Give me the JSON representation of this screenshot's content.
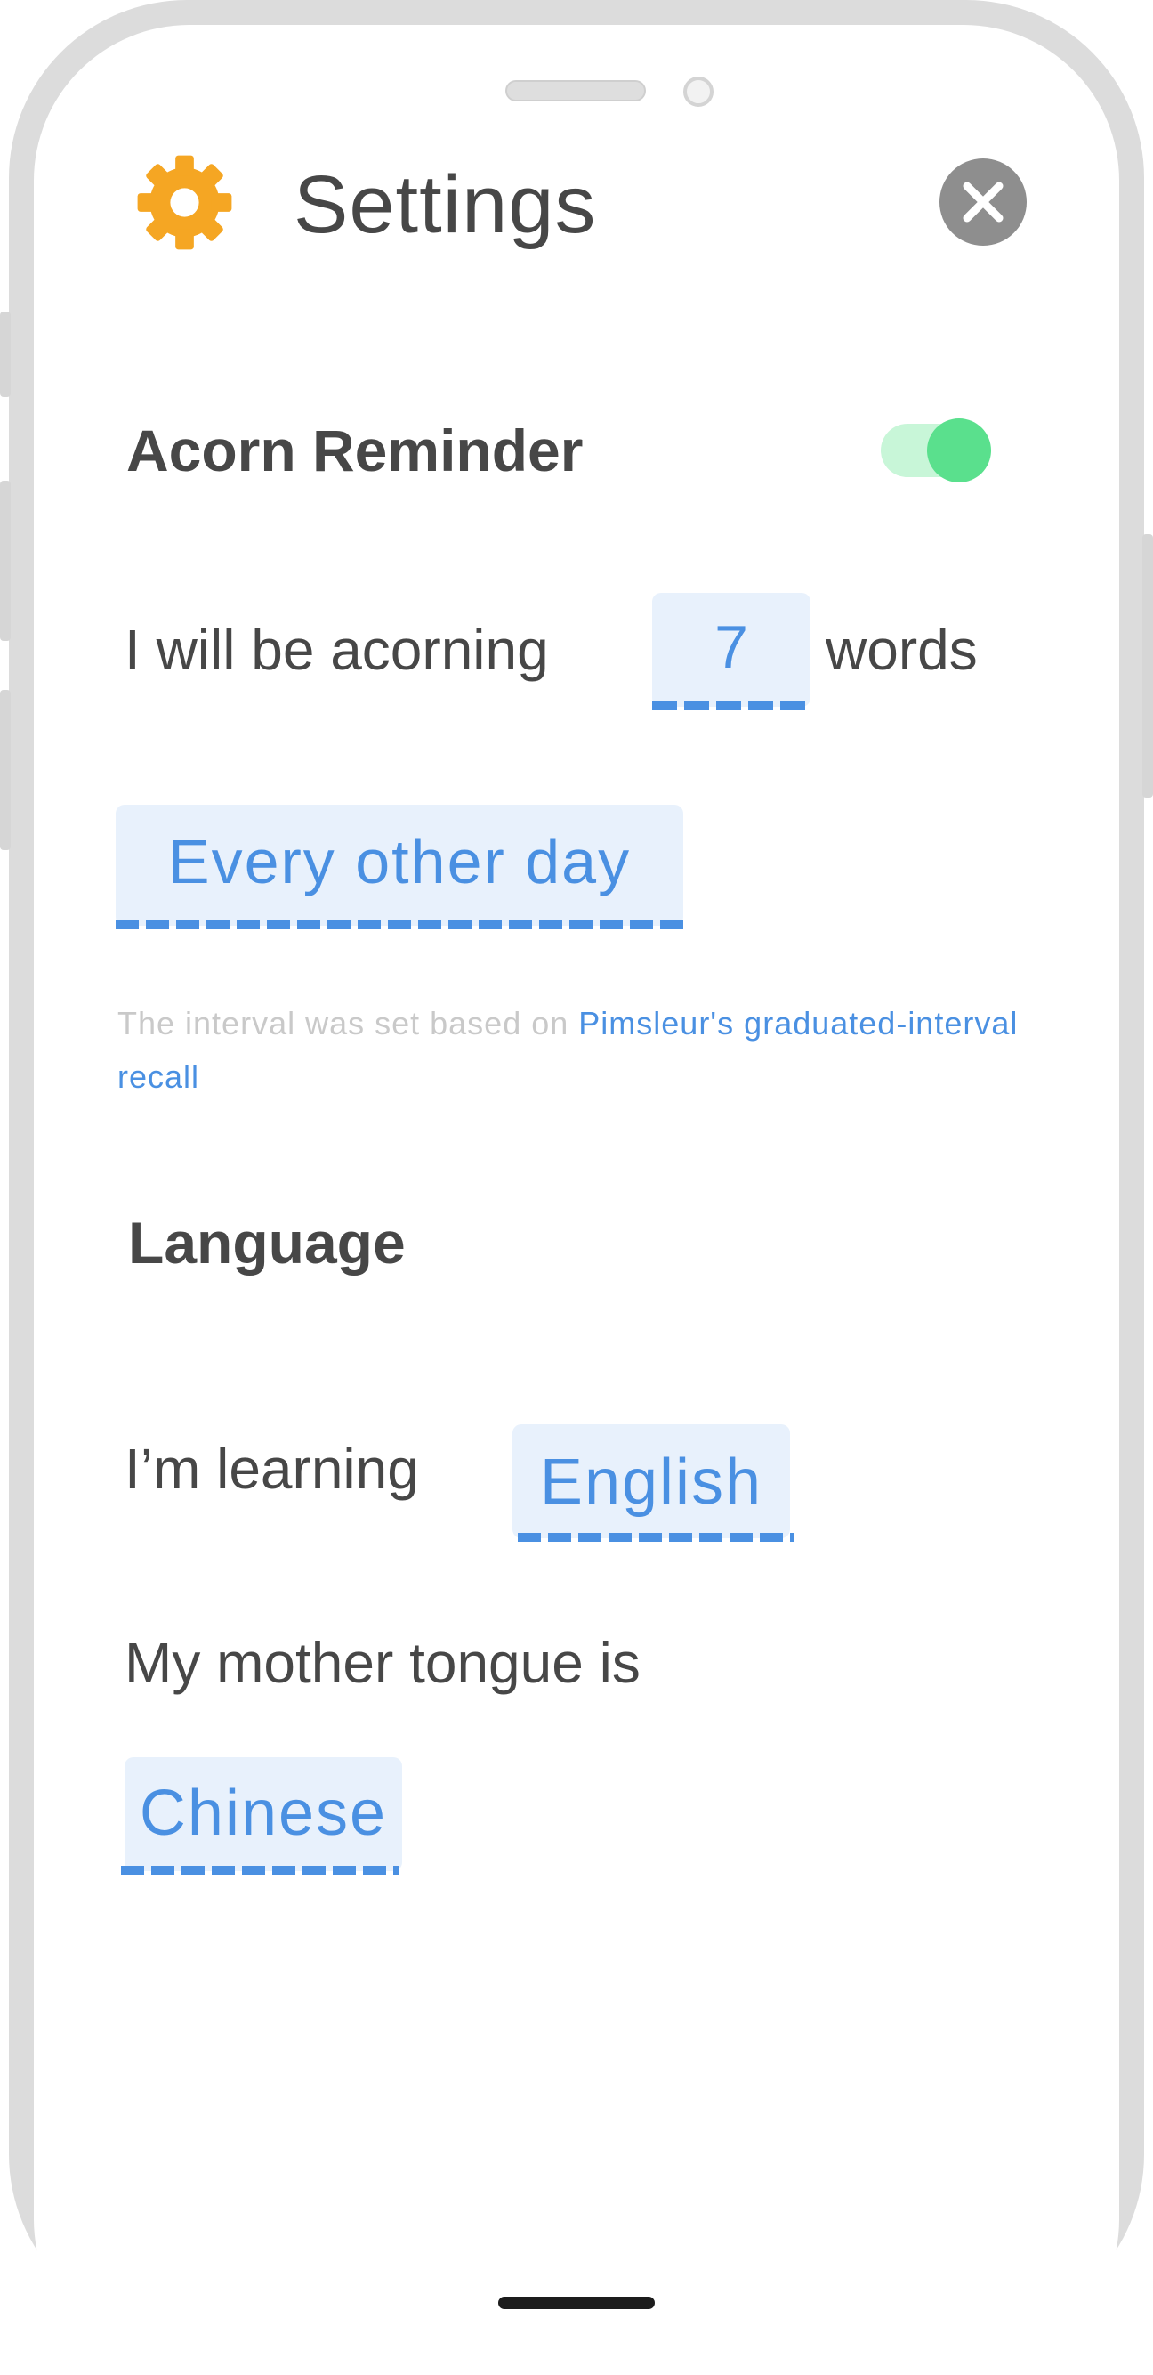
{
  "header": {
    "title": "Settings",
    "settings_icon": "gear-icon",
    "close_icon": "close-icon"
  },
  "reminder": {
    "section_title": "Acorn Reminder",
    "enabled": true,
    "words_prefix": "I will be acorning",
    "words_count": "7",
    "words_suffix": "words",
    "frequency": "Every other day",
    "note_text": "The interval was set based on ",
    "note_link": "Pimsleur's graduated-interval recall"
  },
  "language": {
    "section_title": "Language",
    "learning_label": "I’m learning",
    "learning_value": "English",
    "mother_label": "My mother tongue is",
    "mother_value": "Chinese"
  },
  "colors": {
    "accent": "#4a90e2",
    "field_bg": "#e8f1fc",
    "toggle_on": "#5ae08d",
    "gear": "#f5a623",
    "text": "#474747"
  }
}
